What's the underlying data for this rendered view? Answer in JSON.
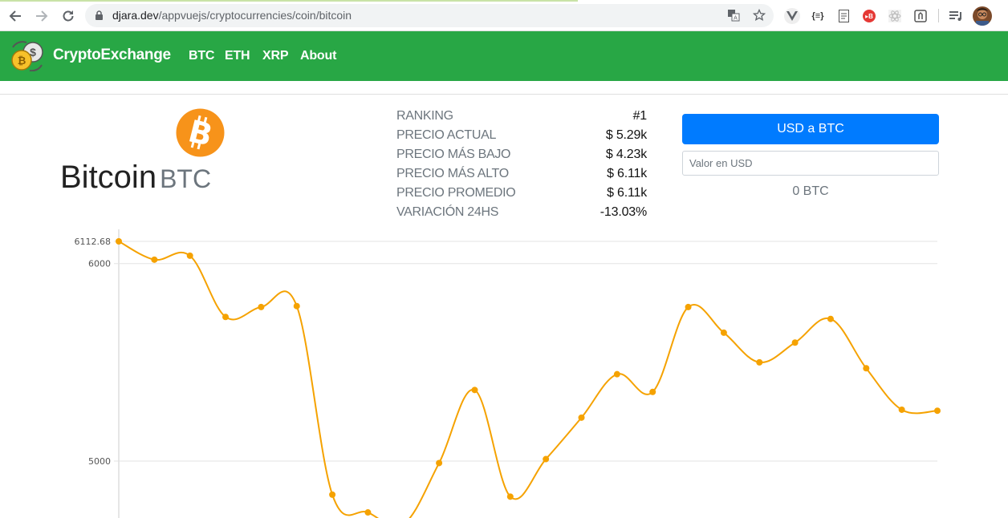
{
  "browser": {
    "url_domain": "djara.dev",
    "url_path": "/appvuejs/cryptocurrencies/coin/bitcoin",
    "extension_icons": [
      "translate-icon",
      "star-icon",
      "vue-devtools-icon",
      "json-viewer-icon",
      "document-icon",
      "hbo-icon",
      "react-icon",
      "lighthouse-icon",
      "playlist-icon",
      "profile-avatar"
    ]
  },
  "navbar": {
    "brand": "CryptoExchange",
    "links": [
      "BTC",
      "ETH",
      "XRP",
      "About"
    ],
    "color": "#28a745"
  },
  "coin": {
    "name": "Bitcoin",
    "symbol": "BTC",
    "icon_color": "#f7931a"
  },
  "stats": [
    {
      "label": "RANKING",
      "value": "#1"
    },
    {
      "label": "PRECIO ACTUAL",
      "value": "$ 5.29k"
    },
    {
      "label": "PRECIO MÁS BAJO",
      "value": "$ 4.23k"
    },
    {
      "label": "PRECIO MÁS ALTO",
      "value": "$ 6.11k"
    },
    {
      "label": "PRECIO PROMEDIO",
      "value": "$ 6.11k"
    },
    {
      "label": "VARIACIÓN 24HS",
      "value": "-13.03%"
    }
  ],
  "converter": {
    "button_label": "USD a BTC",
    "input_placeholder": "Valor en USD",
    "input_value": "",
    "result": "0 BTC",
    "button_color": "#007bff"
  },
  "chart_data": {
    "type": "line",
    "color": "#f5a200",
    "y_tick_labels": [
      "6112.68",
      "6000",
      "5000"
    ],
    "y_ticks": [
      6112.68,
      6000,
      5000
    ],
    "grid": true,
    "values": [
      6112.68,
      6020,
      6040,
      5730,
      5780,
      5785,
      4830,
      4740,
      4680,
      4990,
      5360,
      4820,
      5010,
      5220,
      5440,
      5350,
      5780,
      5650,
      5500,
      5600,
      5720,
      5470,
      5260,
      5255
    ]
  }
}
